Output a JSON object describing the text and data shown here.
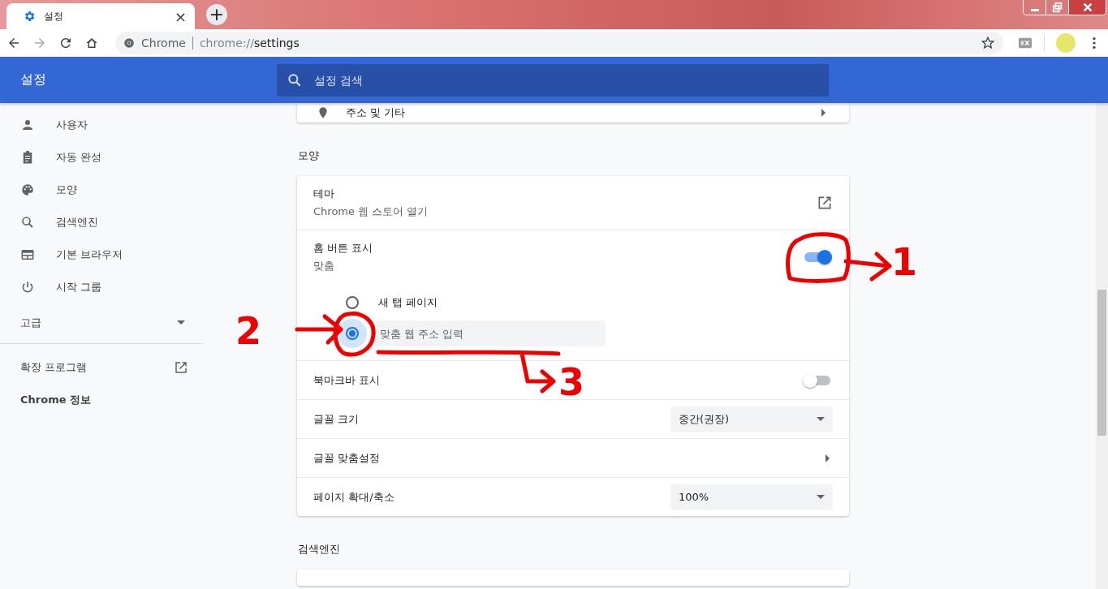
{
  "browser": {
    "tab": {
      "title": "설정",
      "close": "×"
    },
    "new_tab": "+",
    "omnibox": {
      "site": "Chrome",
      "url_scheme": "chrome://",
      "url_path": "settings"
    }
  },
  "header": {
    "title": "설정",
    "search_placeholder": "설정 검색"
  },
  "sidebar": {
    "items": [
      {
        "label": "사용자"
      },
      {
        "label": "자동 완성"
      },
      {
        "label": "모양"
      },
      {
        "label": "검색엔진"
      },
      {
        "label": "기본 브라우저"
      },
      {
        "label": "시작 그룹"
      }
    ],
    "advanced": {
      "label": "고급",
      "expanded": false
    },
    "links": [
      {
        "label": "확장 프로그램",
        "external": true
      },
      {
        "label": "Chrome 정보",
        "external": false
      }
    ]
  },
  "partial_row": {
    "label": "주소 및 기타"
  },
  "sections": [
    {
      "title": "모양",
      "rows": [
        {
          "kind": "link",
          "title": "테마",
          "subtitle": "Chrome 웹 스토어 열기"
        },
        {
          "kind": "toggle",
          "title": "홈 버튼 표시",
          "subtitle": "맞춤",
          "on": true,
          "options": [
            {
              "label": "새 탭 페이지",
              "selected": false
            },
            {
              "placeholder": "맞춤 웹 주소 입력",
              "selected": true
            }
          ]
        },
        {
          "kind": "toggle",
          "title": "북마크바 표시",
          "on": false
        },
        {
          "kind": "select",
          "title": "글꼴 크기",
          "value": "중간(권장)"
        },
        {
          "kind": "submenu",
          "title": "글꼴 맞춤설정"
        },
        {
          "kind": "select",
          "title": "페이지 확대/축소",
          "value": "100%"
        }
      ]
    },
    {
      "title": "검색엔진"
    }
  ],
  "annotations": [
    {
      "label": "1"
    },
    {
      "label": "2"
    },
    {
      "label": "3"
    }
  ]
}
